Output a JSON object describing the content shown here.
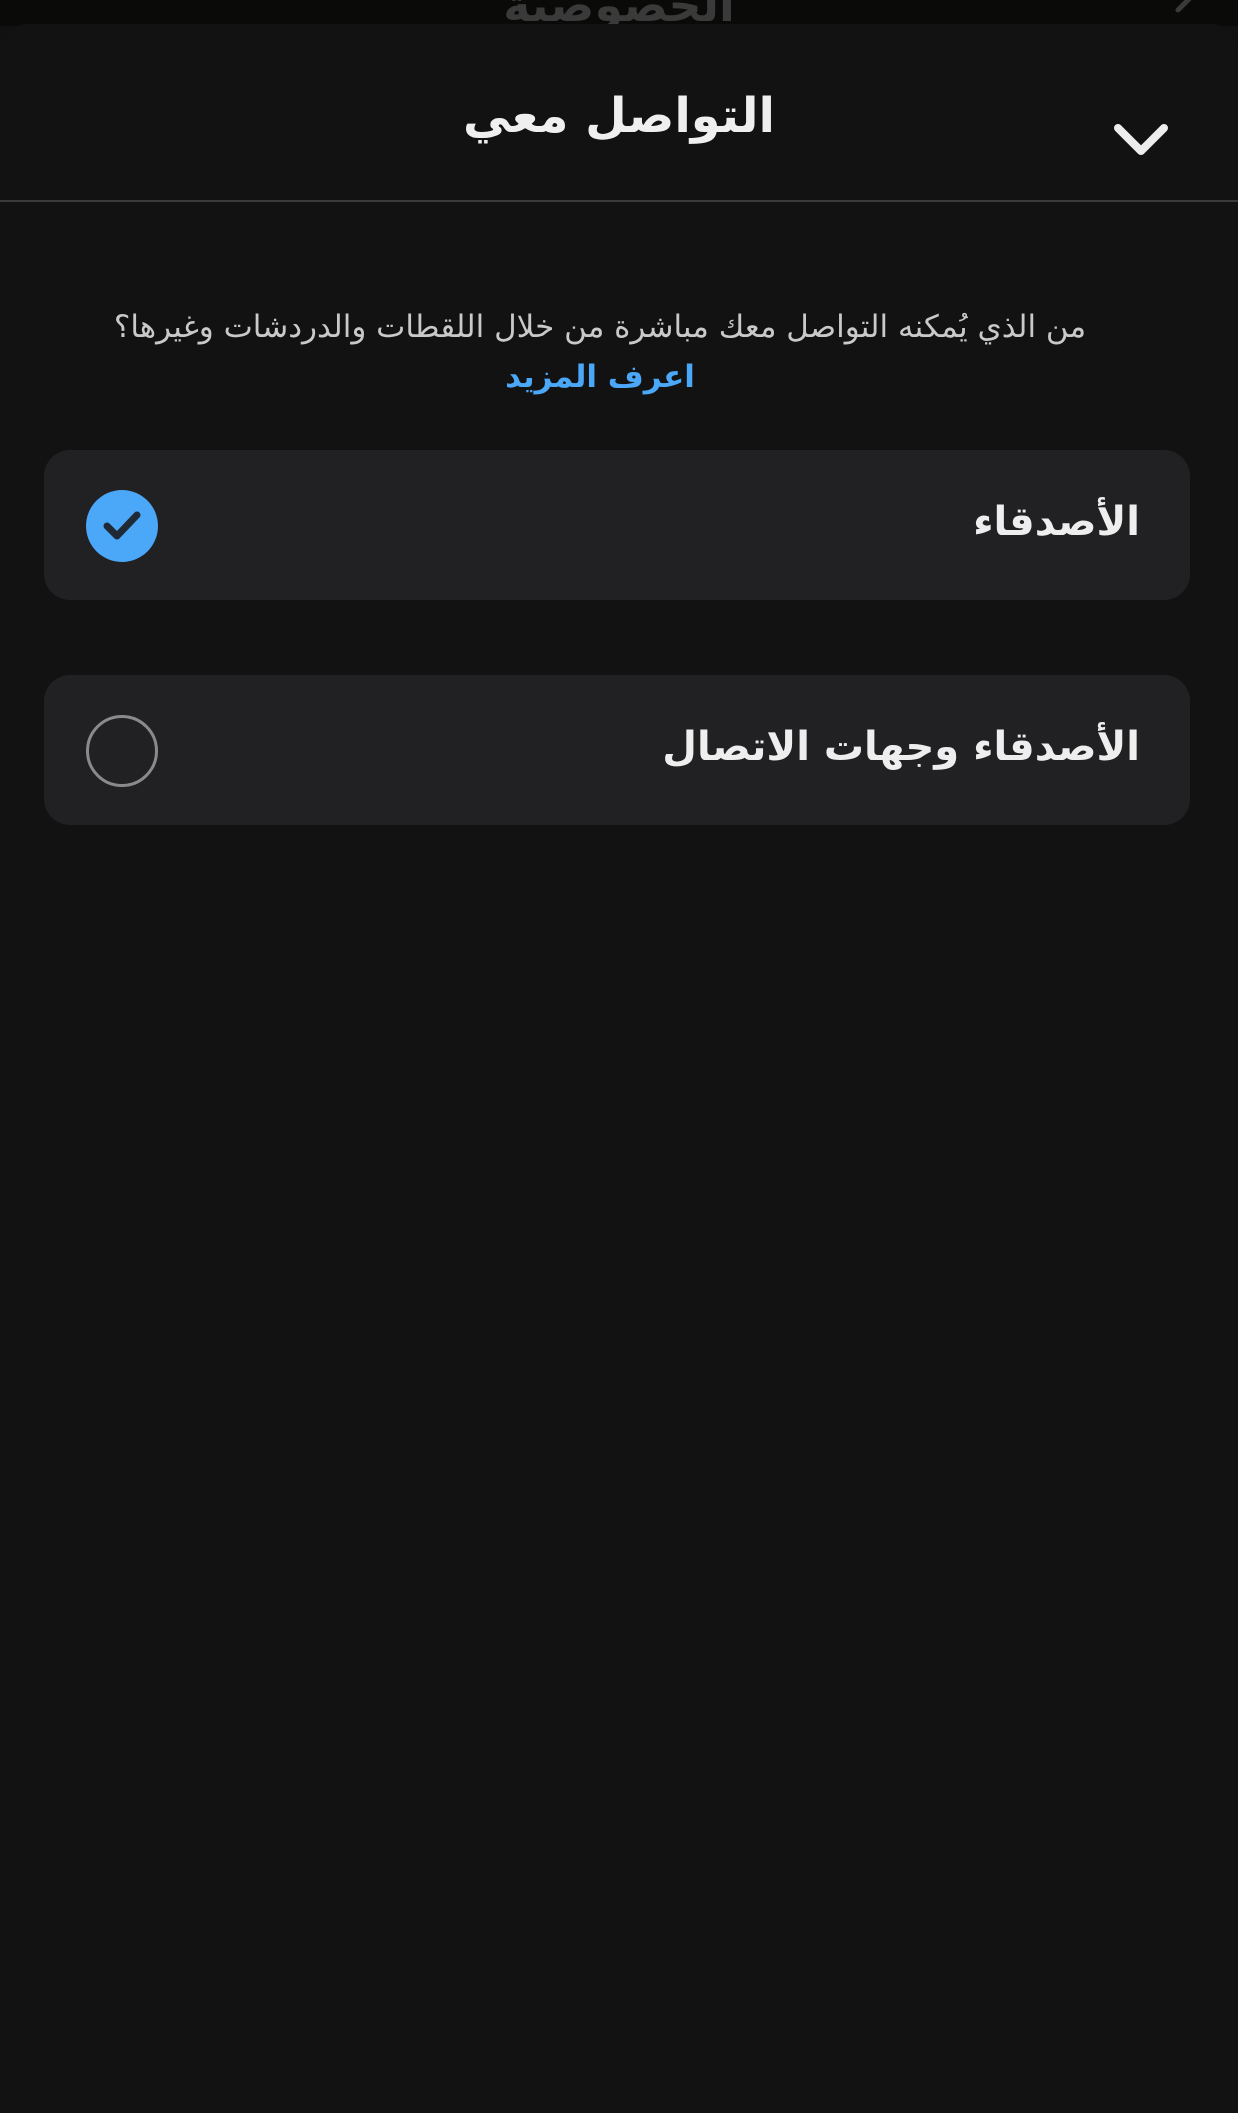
{
  "backdrop": {
    "title": "الخصوصية"
  },
  "sheet": {
    "title": "التواصل معي",
    "collapse_icon": "chevron-down-icon",
    "description": "من الذي يُمكنه التواصل معك مباشرة من خلال اللقطات والدردشات وغيرها؟",
    "learn_more": "اعرف المزيد",
    "options": [
      {
        "label": "الأصدقاء",
        "selected": true
      },
      {
        "label": "الأصدقاء وجهات الاتصال",
        "selected": false
      }
    ]
  },
  "colors": {
    "background": "#121213",
    "option_background": "#212123",
    "accent": "#4ba7f8",
    "text": "#eeeeee",
    "secondary_text": "#c9c9c9"
  }
}
